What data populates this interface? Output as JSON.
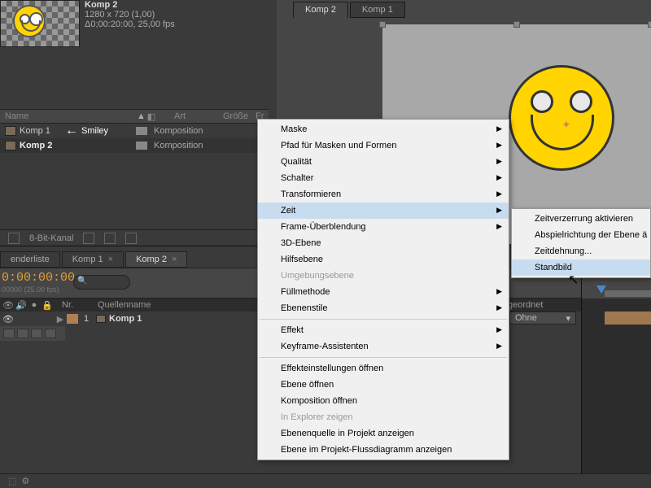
{
  "project": {
    "comp_name": "Komp 2",
    "dimensions": "1280 x 720 (1,00)",
    "duration_fps": "Δ0;00:20:00, 25,00 fps",
    "smiley_annotation": "Smiley",
    "headers": {
      "name": "Name",
      "art": "Art",
      "grosse": "Größe",
      "fr": "Fr"
    },
    "rows": [
      {
        "name": "Komp 1",
        "type": "Komposition"
      },
      {
        "name": "Komp 2",
        "type": "Komposition"
      }
    ],
    "footer_bits": "8-Bit-Kanal"
  },
  "viewer": {
    "tabs": [
      "Komp 2",
      "Komp 1"
    ]
  },
  "timeline": {
    "tabs": [
      "enderliste",
      "Komp 1",
      "Komp 2"
    ],
    "timecode": "0:00:00:00",
    "fps_hint": "00000 (25.00 fps)",
    "cols": {
      "nr": "Nr.",
      "quellenname": "Quellenname",
      "geordnet": "geordnet"
    },
    "layer": {
      "num": "1",
      "name": "Komp 1",
      "parent": "Ohne"
    }
  },
  "menu": {
    "items": [
      {
        "label": "Maske",
        "sub": true
      },
      {
        "label": "Pfad für Masken und Formen",
        "sub": true
      },
      {
        "label": "Qualität",
        "sub": true
      },
      {
        "label": "Schalter",
        "sub": true
      },
      {
        "label": "Transformieren",
        "sub": true
      },
      {
        "label": "Zeit",
        "sub": true,
        "highlighted": true
      },
      {
        "label": "Frame-Überblendung",
        "sub": true
      },
      {
        "label": "3D-Ebene"
      },
      {
        "label": "Hilfsebene"
      },
      {
        "label": "Umgebungsebene",
        "disabled": true
      },
      {
        "label": "Füllmethode",
        "sub": true
      },
      {
        "label": "Ebenenstile",
        "sub": true
      },
      {
        "sep": true
      },
      {
        "label": "Effekt",
        "sub": true
      },
      {
        "label": "Keyframe-Assistenten",
        "sub": true
      },
      {
        "sep": true
      },
      {
        "label": "Effekteinstellungen öffnen"
      },
      {
        "label": "Ebene öffnen"
      },
      {
        "label": "Komposition öffnen"
      },
      {
        "label": "In Explorer zeigen",
        "disabled": true
      },
      {
        "label": "Ebenenquelle in Projekt anzeigen"
      },
      {
        "label": "Ebene im Projekt-Flussdiagramm anzeigen"
      }
    ],
    "submenu": [
      {
        "label": "Zeitverzerrung aktivieren"
      },
      {
        "label": "Abspielrichtung der Ebene ä"
      },
      {
        "label": "Zeitdehnung..."
      },
      {
        "label": "Standbild",
        "highlighted": true
      }
    ]
  }
}
